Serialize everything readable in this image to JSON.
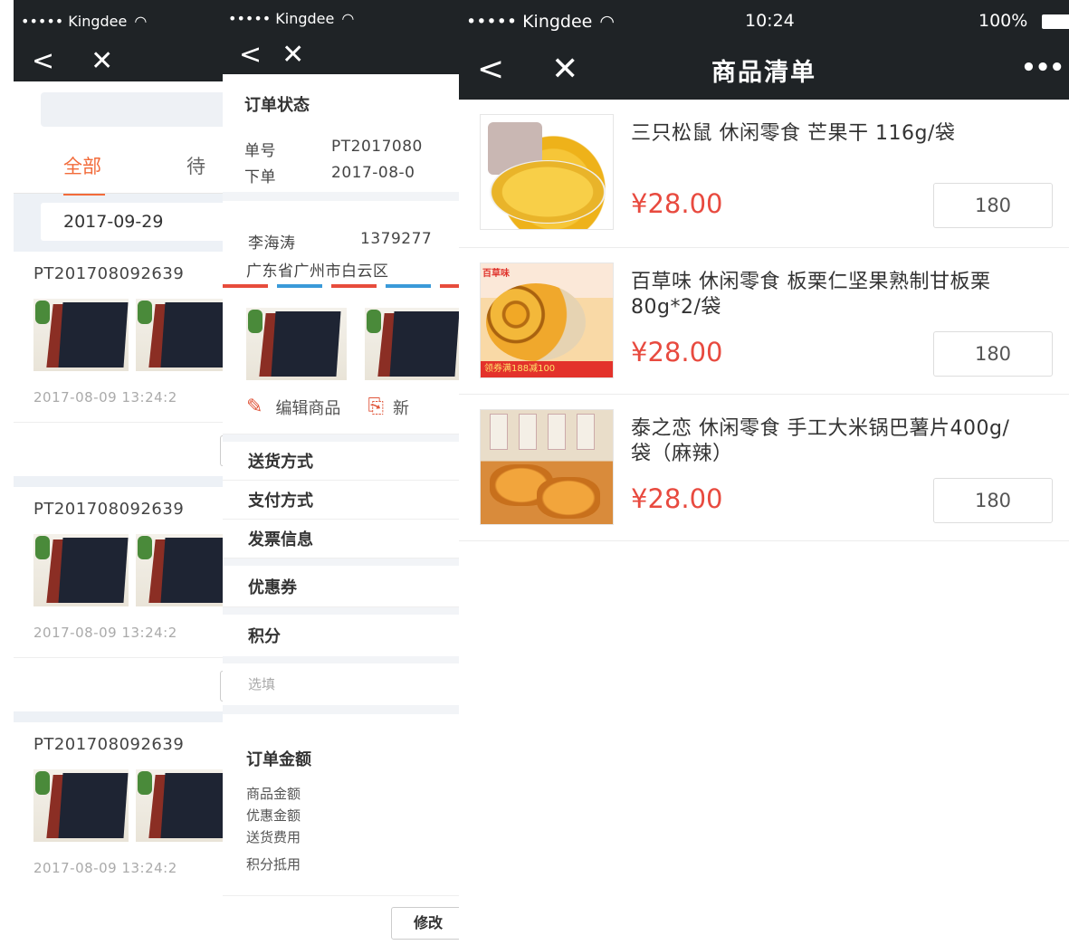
{
  "statusbar": {
    "carrier": "••••• Kingdee",
    "time": "10:24",
    "battery": "100%"
  },
  "nav": {
    "back": "<",
    "close": "✕",
    "more": "•••"
  },
  "screen1": {
    "tabs": {
      "active": "全部",
      "next": "待"
    },
    "date": "2017-09-29",
    "orders": [
      {
        "no": "PT201708092639",
        "time": "2017-08-09  13:24:2"
      },
      {
        "no": "PT201708092639",
        "time": "2017-08-09  13:24:2"
      },
      {
        "no": "PT201708092639",
        "time": "2017-08-09  13:24:2"
      }
    ]
  },
  "screen2": {
    "order_status_title": "订单状态",
    "order_no_key": "单号",
    "order_no_val": "PT2017080",
    "order_time_key": "下单",
    "order_time_val": "2017-08-0",
    "contact_name": "李海涛",
    "contact_phone": "1379277",
    "address": "广东省广州市白云区",
    "edit_goods": "编辑商品",
    "copy_goods": "新",
    "menu_delivery": "送货方式",
    "menu_payment": "支付方式",
    "menu_invoice": "发票信息",
    "menu_coupon": "优惠券",
    "menu_points": "积分",
    "points_placeholder": "选填",
    "amount_title": "订单金额",
    "amount_goods": "商品金额",
    "amount_discount": "优惠金额",
    "amount_delivery": "送货费用",
    "amount_points": "积分抵用",
    "modify_button": "修改"
  },
  "screen3": {
    "title": "商品清单",
    "products": [
      {
        "name": "三只松鼠 休闲零食 芒果干 116g/袋",
        "price": "¥28.00",
        "qty": "180"
      },
      {
        "name": "百草味 休闲零食 板栗仁坚果熟制甘板栗 80g*2/袋",
        "price": "¥28.00",
        "qty": "180"
      },
      {
        "name": "泰之恋 休闲零食 手工大米锅巴薯片400g/袋（麻辣）",
        "price": "¥28.00",
        "qty": "180"
      }
    ],
    "chestnut_img_logo": "百草味",
    "chestnut_img_banner": "领券满188减100"
  },
  "colors": {
    "navbar": "#1f2326",
    "accent": "#f26b3a",
    "price": "#e84a3f"
  }
}
